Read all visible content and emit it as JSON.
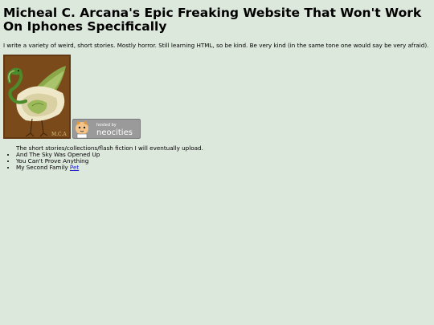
{
  "header": {
    "title": "Micheal C. Arcana's Epic Freaking Website That Won't Work On Iphones Specifically"
  },
  "intro": {
    "text": "I write a variety of weird, short stories. Mostly horror. Still learning HTML, so be kind. Be very kind (in the same tone one would say be very afraid)."
  },
  "art": {
    "signature": "M.C.A",
    "colors": {
      "background": "#7a4a1a",
      "feather_green": "#8aa84a",
      "feather_cream": "#efe8c8",
      "snake_green": "#4d8a2a"
    }
  },
  "badge": {
    "line1": "hosted by",
    "line2": "neocities",
    "colors": {
      "background": "#9a9a9a",
      "text": "#ffffff"
    }
  },
  "list": {
    "heading": "The short stories/collections/flash fiction I will eventually upload.",
    "items": [
      {
        "text": "And The Sky Was Opened Up"
      },
      {
        "text": "You Can't Prove Anything"
      },
      {
        "text": "My Second Family ",
        "link": "Pet"
      }
    ]
  },
  "colors": {
    "page_background": "#dde8dd",
    "link": "#2222cc"
  }
}
